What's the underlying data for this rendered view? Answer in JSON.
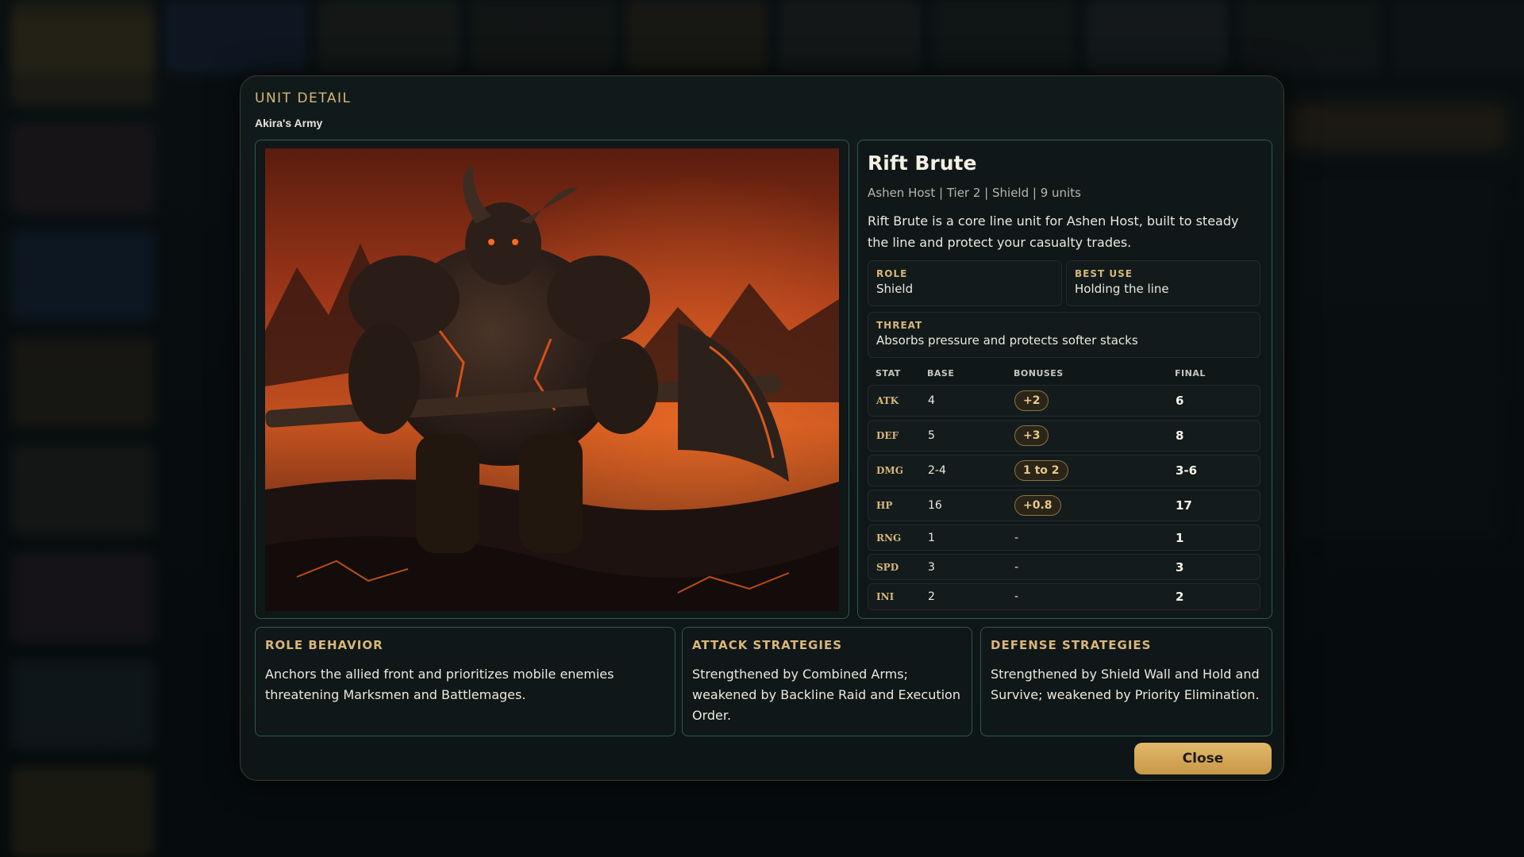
{
  "modal": {
    "kicker": "UNIT DETAIL",
    "subtitle": "Akira's Army",
    "close_label": "Close"
  },
  "unit": {
    "name": "Rift Brute",
    "meta": "Ashen Host | Tier 2 | Shield | 9 units",
    "description": "Rift Brute is a core line unit for Ashen Host, built to steady the line and protect your casualty trades.",
    "role_label": "ROLE",
    "role_value": "Shield",
    "best_use_label": "BEST USE",
    "best_use_value": "Holding the line",
    "threat_label": "THREAT",
    "threat_value": "Absorbs pressure and protects softer stacks"
  },
  "stats": {
    "headers": {
      "stat": "STAT",
      "base": "BASE",
      "bonuses": "BONUSES",
      "final": "FINAL"
    },
    "rows": [
      {
        "stat": "ATK",
        "base": "4",
        "bonus": "+2",
        "final": "6"
      },
      {
        "stat": "DEF",
        "base": "5",
        "bonus": "+3",
        "final": "8"
      },
      {
        "stat": "DMG",
        "base": "2-4",
        "bonus": "1 to 2",
        "final": "3-6"
      },
      {
        "stat": "HP",
        "base": "16",
        "bonus": "+0.8",
        "final": "17"
      },
      {
        "stat": "RNG",
        "base": "1",
        "bonus": "-",
        "final": "1"
      },
      {
        "stat": "SPD",
        "base": "3",
        "bonus": "-",
        "final": "3"
      },
      {
        "stat": "INI",
        "base": "2",
        "bonus": "-",
        "final": "2"
      }
    ]
  },
  "strategies": {
    "role_behavior_title": "ROLE BEHAVIOR",
    "role_behavior_text": "Anchors the allied front and prioritizes mobile enemies threatening Marksmen and Battlemages.",
    "attack_title": "ATTACK STRATEGIES",
    "attack_text": "Strengthened by Combined Arms; weakened by Backline Raid and Execution Order.",
    "defense_title": "DEFENSE STRATEGIES",
    "defense_text": "Strengthened by Shield Wall and Hold and Survive; weakened by Priority Elimination."
  },
  "colors": {
    "accent_gold": "#d9b679",
    "panel_border": "#2f5a4f",
    "button_gold": "#e2b96b"
  }
}
